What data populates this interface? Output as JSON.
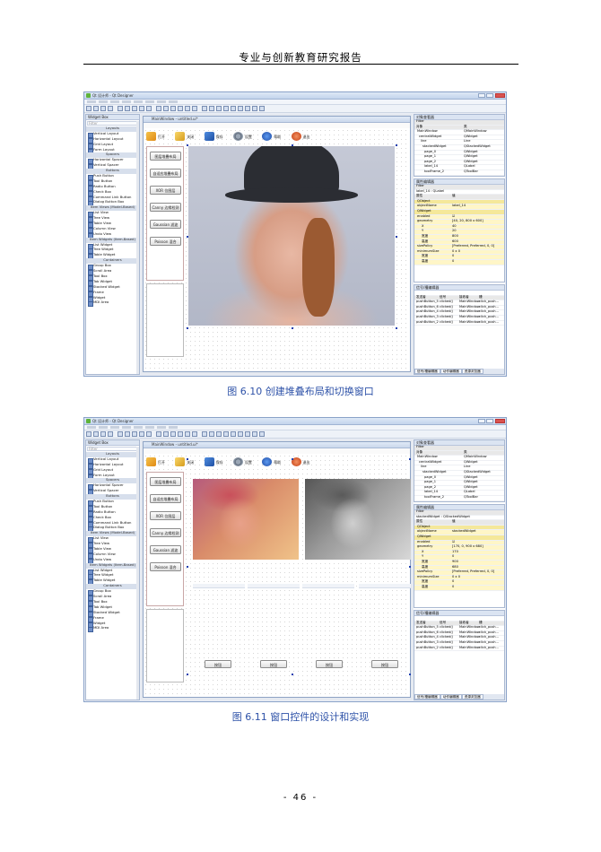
{
  "header": "专业与创新教育研究报告",
  "page_number": "- 46 -",
  "captions": [
    "图 6.10 创建堆叠布局和切换窗口",
    "图 6.11 窗口控件的设计和实现"
  ],
  "app": {
    "title": "Qt 设计师 - Qt Designer",
    "widget_box_title": "Widget Box",
    "filter": "Filter",
    "widget_items": [
      {
        "t": "Layouts",
        "cat": true
      },
      {
        "t": "Vertical Layout"
      },
      {
        "t": "Horizontal Layout"
      },
      {
        "t": "Grid Layout"
      },
      {
        "t": "Form Layout"
      },
      {
        "t": "Spacers",
        "cat": true
      },
      {
        "t": "Horizontal Spacer"
      },
      {
        "t": "Vertical Spacer"
      },
      {
        "t": "Buttons",
        "cat": true
      },
      {
        "t": "Push Button"
      },
      {
        "t": "Tool Button"
      },
      {
        "t": "Radio Button"
      },
      {
        "t": "Check Box"
      },
      {
        "t": "Command Link Button"
      },
      {
        "t": "Dialog Button Box"
      },
      {
        "t": "Item Views (Model-Based)",
        "cat": true
      },
      {
        "t": "List View"
      },
      {
        "t": "Tree View"
      },
      {
        "t": "Table View"
      },
      {
        "t": "Column View"
      },
      {
        "t": "Undo View"
      },
      {
        "t": "Item Widgets (Item-Based)",
        "cat": true
      },
      {
        "t": "List Widget"
      },
      {
        "t": "Tree Widget"
      },
      {
        "t": "Table Widget"
      },
      {
        "t": "Containers",
        "cat": true
      },
      {
        "t": "Group Box"
      },
      {
        "t": "Scroll Area"
      },
      {
        "t": "Tool Box"
      },
      {
        "t": "Tab Widget"
      },
      {
        "t": "Stacked Widget"
      },
      {
        "t": "Frame"
      },
      {
        "t": "Widget"
      },
      {
        "t": "MDI Area"
      }
    ],
    "form_title": "MainWindow - untitled.ui*",
    "toolbar_actions": [
      "打开",
      "关闭",
      "保存",
      "设置",
      "帮助",
      "退出"
    ],
    "side_buttons": [
      "图层堆叠布局",
      "自适应堆叠布局",
      "XOR 位图层",
      "Canny 边缘检测",
      "Gaussian 滤波",
      "Poisson 混合"
    ],
    "small_buttons": [
      "按钮",
      "按钮",
      "按钮",
      "按钮"
    ],
    "object_inspector": {
      "title": "对象查看器",
      "headers": [
        "对象",
        "类"
      ],
      "rows": [
        [
          "MainWindow",
          "QMainWindow"
        ],
        [
          "centralWidget",
          "QWidget"
        ],
        [
          "line",
          "Line"
        ],
        [
          "stackedWidget",
          "QStackedWidget"
        ],
        [
          "page_0",
          "QWidget"
        ],
        [
          "page_1",
          "QWidget"
        ],
        [
          "page_2",
          "QWidget"
        ],
        [
          "label_14",
          "QLabel"
        ],
        [
          "toolFrame_2",
          "QToolBar"
        ]
      ]
    },
    "property_editor": {
      "title": "属性编辑器",
      "object_1": "label_14 : QLabel",
      "object_2": "stackedWidget : QStackedWidget",
      "headers": [
        "属性",
        "值"
      ],
      "rows_1": [
        [
          "QObject",
          ""
        ],
        [
          "objectName",
          "label_14"
        ],
        [
          "QWidget",
          ""
        ],
        [
          "enabled",
          "☑"
        ],
        [
          "geometry",
          "[40, 20, 800 x 600]"
        ],
        [
          "X",
          "40"
        ],
        [
          "Y",
          "20"
        ],
        [
          "宽度",
          "800"
        ],
        [
          "高度",
          "600"
        ],
        [
          "sizePolicy",
          "[Preferred, Preferred, 0, 0]"
        ],
        [
          "minimumSize",
          "0 x 0"
        ],
        [
          "宽度",
          "0"
        ],
        [
          "高度",
          "0"
        ]
      ],
      "rows_2": [
        [
          "QObject",
          ""
        ],
        [
          "objectName",
          "stackedWidget"
        ],
        [
          "QWidget",
          ""
        ],
        [
          "enabled",
          "☑"
        ],
        [
          "geometry",
          "[170, 0, 900 x 680]"
        ],
        [
          "X",
          "170"
        ],
        [
          "Y",
          "0"
        ],
        [
          "宽度",
          "900"
        ],
        [
          "高度",
          "680"
        ],
        [
          "sizePolicy",
          "[Preferred, Preferred, 0, 0]"
        ],
        [
          "minimumSize",
          "0 x 0"
        ],
        [
          "宽度",
          "0"
        ],
        [
          "高度",
          "0"
        ]
      ]
    },
    "signal_editor": {
      "title": "信号/槽编辑器",
      "headers": [
        "发送者",
        "信号",
        "接收者",
        "槽"
      ],
      "rows": [
        [
          "pushButton_5",
          "clicked()",
          "MainWindow",
          "click_push..."
        ],
        [
          "pushButton_6",
          "clicked()",
          "MainWindow",
          "click_push..."
        ],
        [
          "pushButton_4",
          "clicked()",
          "MainWindow",
          "click_push..."
        ],
        [
          "pushButton_3",
          "clicked()",
          "MainWindow",
          "click_push..."
        ],
        [
          "pushButton_2",
          "clicked()",
          "MainWindow",
          "click_push..."
        ]
      ]
    },
    "bottom_tabs": [
      "信号/槽编辑器",
      "动作编辑器",
      "资源浏览器"
    ]
  }
}
